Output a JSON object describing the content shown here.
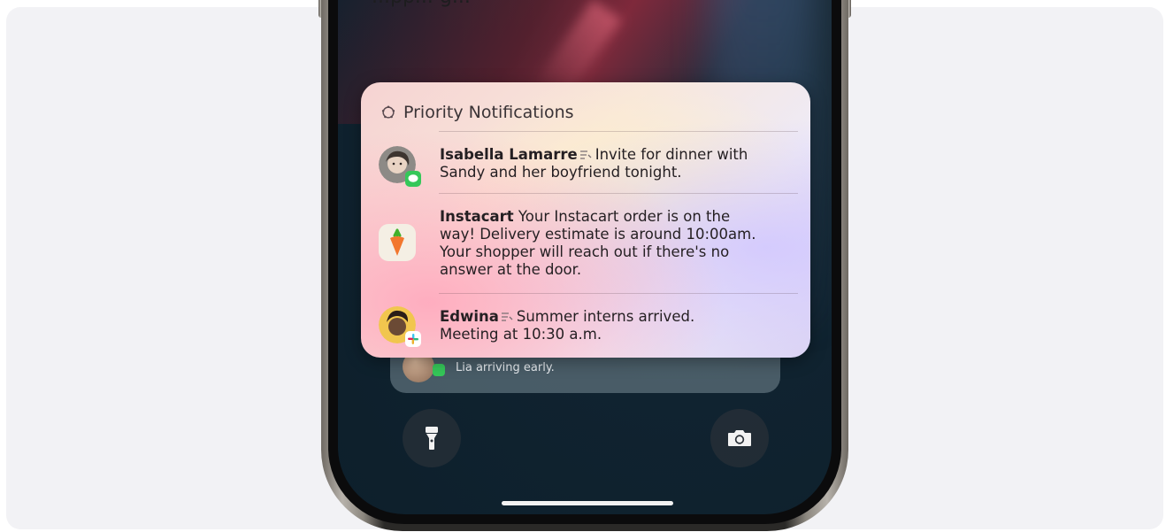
{
  "caption": {
    "text": "...pp... g..."
  },
  "priority": {
    "header_title": "Priority Notifications",
    "notifications": [
      {
        "sender": "Isabella Lamarre",
        "line1": "Invite for dinner with",
        "line2": "Sandy and her boyfriend tonight.",
        "app": "Messages"
      },
      {
        "sender": "Instacart",
        "line1": "Your Instacart order is on the",
        "line2": "way! Delivery estimate is around 10:00am.",
        "line3": "Your shopper will reach out if there's no",
        "line4": "answer at the door.",
        "app": "Instacart"
      },
      {
        "sender": "Edwina",
        "line1": "Summer interns arrived.",
        "line2": "Meeting at 10:30 a.m.",
        "app": "Slack"
      }
    ]
  },
  "stacked_notification": {
    "text": "Lia arriving early."
  },
  "controls": {
    "flashlight": "flashlight-icon",
    "camera": "camera-icon"
  },
  "colors": {
    "background": "#f2f2f5",
    "messages_green": "#35c759",
    "instacart_orange": "#f2772e",
    "instacart_green": "#43b02a"
  }
}
